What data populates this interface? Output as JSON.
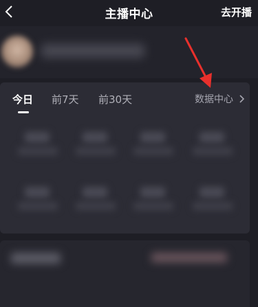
{
  "header": {
    "title": "主播中心",
    "go_live": "去开播"
  },
  "stats": {
    "tabs": [
      {
        "label": "今日",
        "active": true
      },
      {
        "label": "前7天",
        "active": false
      },
      {
        "label": "前30天",
        "active": false
      }
    ],
    "data_center": "数据中心"
  },
  "colors": {
    "background": "#1e1e25",
    "card": "#2c2c35",
    "annotation_arrow": "#e8302c"
  }
}
